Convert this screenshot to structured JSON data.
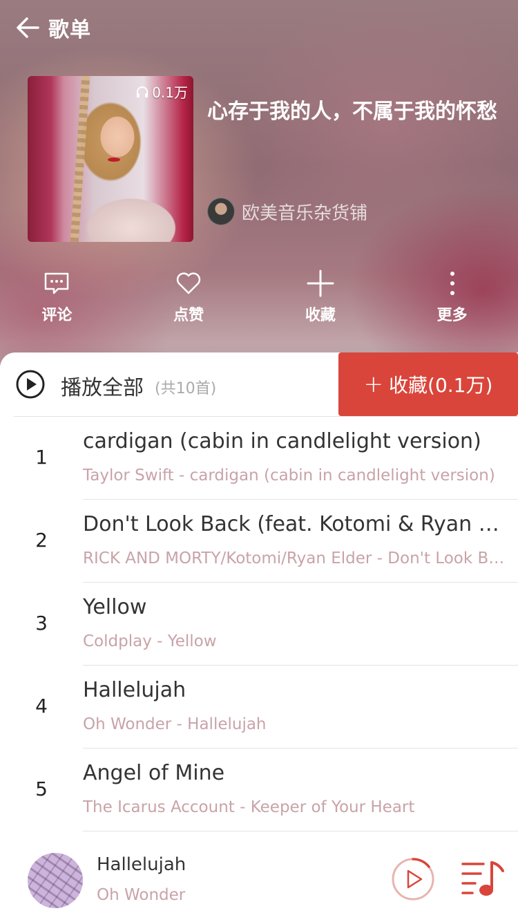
{
  "header": {
    "title": "歌单",
    "play_count": "0.1万",
    "playlist_title": "心存于我的人，不属于我的怀愁",
    "creator_name": "欧美音乐杂货铺"
  },
  "actions": [
    {
      "label": "评论",
      "icon": "comment-icon"
    },
    {
      "label": "点赞",
      "icon": "heart-icon"
    },
    {
      "label": "收藏",
      "icon": "plus-icon"
    },
    {
      "label": "更多",
      "icon": "more-icon"
    }
  ],
  "playall": {
    "label": "播放全部",
    "count": "(共10首)",
    "collect_label": "收藏(0.1万)"
  },
  "songs": [
    {
      "index": "1",
      "title": "cardigan (cabin in candlelight version)",
      "subtitle": "Taylor Swift - cardigan (cabin in candlelight version)"
    },
    {
      "index": "2",
      "title": "Don't Look Back (feat. Kotomi & Ryan Elder)",
      "subtitle": "RICK AND MORTY/Kotomi/Ryan Elder - Don't Look Back (feat. Kotomi & Ryan Elder)"
    },
    {
      "index": "3",
      "title": "Yellow",
      "subtitle": "Coldplay - Yellow"
    },
    {
      "index": "4",
      "title": "Hallelujah",
      "subtitle": "Oh Wonder - Hallelujah"
    },
    {
      "index": "5",
      "title": "Angel of Mine",
      "subtitle": "The Icarus Account - Keeper of Your Heart"
    }
  ],
  "player": {
    "title": "Hallelujah",
    "artist": "Oh Wonder"
  },
  "colors": {
    "accent": "#d9453a",
    "subtitle": "#c8a3a8"
  }
}
